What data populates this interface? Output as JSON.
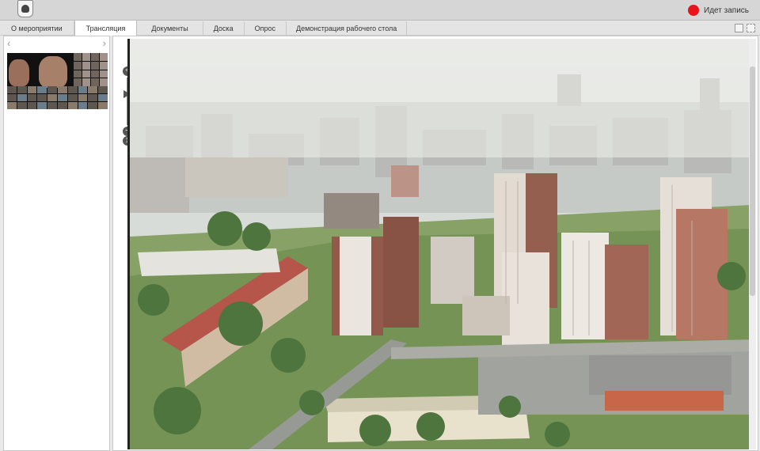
{
  "header": {
    "recording_label": "Идет запись",
    "recording_color": "#e8141b"
  },
  "tabs": [
    {
      "label": "О мероприятии"
    },
    {
      "label": "Трансляция",
      "active": true
    },
    {
      "label": "Документы"
    },
    {
      "label": "Доска"
    },
    {
      "label": "Опрос"
    },
    {
      "label": "Демонстрация рабочего стола"
    }
  ],
  "sidebar": {
    "prev_icon": "chevron-left-icon",
    "next_icon": "chevron-right-icon"
  },
  "zoom": {
    "plus": "+",
    "minus": "−",
    "reset": "1"
  }
}
